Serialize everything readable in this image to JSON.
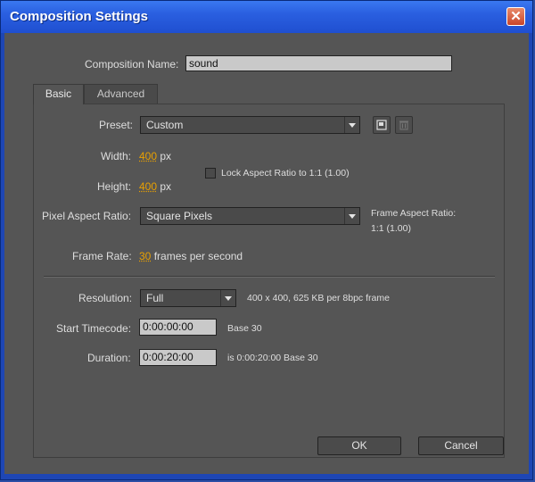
{
  "window": {
    "title": "Composition Settings",
    "close_label": "✕"
  },
  "composition_name": {
    "label": "Composition Name:",
    "value": "sound"
  },
  "tabs": [
    {
      "label": "Basic"
    },
    {
      "label": "Advanced"
    }
  ],
  "preset": {
    "label": "Preset:",
    "value": "Custom"
  },
  "width": {
    "label": "Width:",
    "value": "400",
    "unit": "px"
  },
  "height": {
    "label": "Height:",
    "value": "400",
    "unit": "px"
  },
  "lock_aspect": {
    "label": "Lock Aspect Ratio to 1:1 (1.00)",
    "checked": false
  },
  "pixel_aspect": {
    "label": "Pixel Aspect Ratio:",
    "value": "Square Pixels"
  },
  "frame_aspect": {
    "label": "Frame Aspect Ratio:",
    "value": "1:1 (1.00)"
  },
  "frame_rate": {
    "label": "Frame Rate:",
    "value": "30",
    "unit": "frames per second"
  },
  "resolution": {
    "label": "Resolution:",
    "value": "Full",
    "info": "400 x 400, 625 KB per 8bpc frame"
  },
  "start_timecode": {
    "label": "Start Timecode:",
    "value": "0:00:00:00",
    "info": "Base 30"
  },
  "duration": {
    "label": "Duration:",
    "value": "0:00:20:00",
    "info": "is 0:00:20:00  Base 30"
  },
  "buttons": {
    "ok": "OK",
    "cancel": "Cancel"
  }
}
